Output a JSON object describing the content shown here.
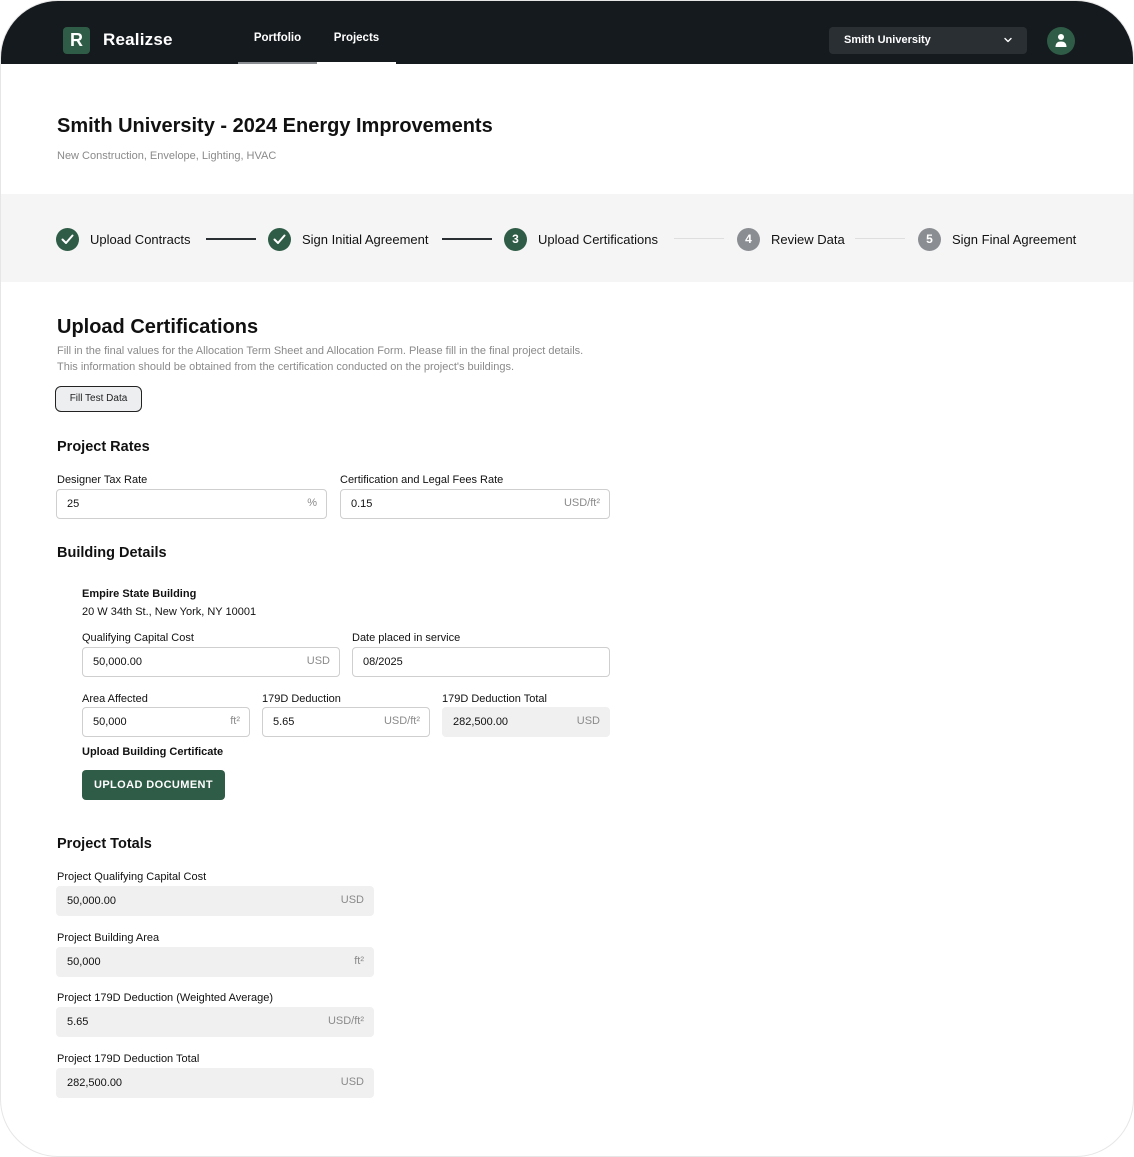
{
  "app": {
    "logo_letter": "R",
    "brand": "Realizse"
  },
  "nav": {
    "tabs": [
      {
        "label": "Portfolio"
      },
      {
        "label": "Projects"
      }
    ]
  },
  "org_select": {
    "value": "Smith University"
  },
  "header": {
    "title": "Smith University - 2024 Energy Improvements",
    "subtitle": "New Construction, Envelope, Lighting, HVAC"
  },
  "stepper": {
    "steps": [
      {
        "label": "Upload Contracts",
        "status": "done"
      },
      {
        "label": "Sign Initial Agreement",
        "status": "done"
      },
      {
        "number": "3",
        "label": "Upload Certifications",
        "status": "current"
      },
      {
        "number": "4",
        "label": "Review Data",
        "status": "pending"
      },
      {
        "number": "5",
        "label": "Sign Final Agreement",
        "status": "pending"
      }
    ]
  },
  "section": {
    "title": "Upload Certifications",
    "desc_line1": "Fill in the final values for the Allocation Term Sheet and Allocation Form. Please fill in the final project details.",
    "desc_line2": "This information should be obtained from the certification conducted on the project's buildings.",
    "fill_test_data": "Fill Test Data"
  },
  "project_rates": {
    "title": "Project Rates",
    "designer_tax_rate": {
      "label": "Designer Tax Rate",
      "value": "25",
      "unit": "%"
    },
    "cert_legal_fees": {
      "label": "Certification and Legal Fees Rate",
      "value": "0.15",
      "unit": "USD/ft²"
    }
  },
  "building_details": {
    "title": "Building Details",
    "building": {
      "name": "Empire State Building",
      "address": "20 W 34th St., New York, NY 10001",
      "qualifying_capital_cost": {
        "label": "Qualifying Capital Cost",
        "value": "50,000.00",
        "unit": "USD"
      },
      "date_placed": {
        "label": "Date placed in service",
        "value": "08/2025"
      },
      "area_affected": {
        "label": "Area Affected",
        "value": "50,000",
        "unit": "ft²"
      },
      "deduction": {
        "label": "179D Deduction",
        "value": "5.65",
        "unit": "USD/ft²"
      },
      "deduction_total": {
        "label": "179D Deduction Total",
        "value": "282,500.00",
        "unit": "USD"
      },
      "upload_label": "Upload Building Certificate",
      "upload_button": "UPLOAD DOCUMENT"
    }
  },
  "project_totals": {
    "title": "Project Totals",
    "qualifying_capital_cost": {
      "label": "Project Qualifying Capital Cost",
      "value": "50,000.00",
      "unit": "USD"
    },
    "building_area": {
      "label": "Project Building Area",
      "value": "50,000",
      "unit": "ft²"
    },
    "weighted_deduction": {
      "label": "Project 179D Deduction (Weighted Average)",
      "value": "5.65",
      "unit": "USD/ft²"
    },
    "deduction_total": {
      "label": "Project 179D Deduction Total",
      "value": "282,500.00",
      "unit": "USD"
    }
  }
}
